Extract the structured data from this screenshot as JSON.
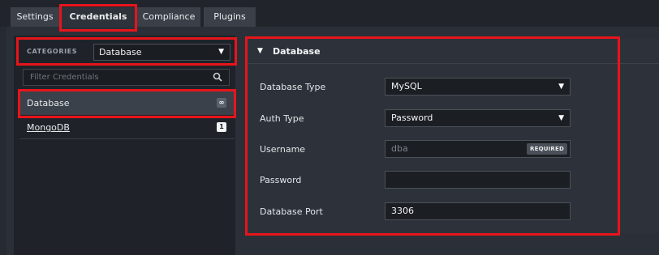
{
  "tabs": [
    {
      "label": "Settings"
    },
    {
      "label": "Credentials"
    },
    {
      "label": "Compliance"
    },
    {
      "label": "Plugins"
    }
  ],
  "categories": {
    "label": "CATEGORIES",
    "selected": "Database"
  },
  "filter": {
    "placeholder": "Filter Credentials"
  },
  "credential_list": [
    {
      "label": "Database",
      "badge": "∞"
    },
    {
      "label": "MongoDB",
      "badge": "1"
    }
  ],
  "form": {
    "section_title": "Database",
    "database_type": {
      "label": "Database Type",
      "value": "MySQL"
    },
    "auth_type": {
      "label": "Auth Type",
      "value": "Password"
    },
    "username": {
      "label": "Username",
      "placeholder": "dba",
      "badge": "REQUIRED"
    },
    "password": {
      "label": "Password",
      "value": ""
    },
    "database_port": {
      "label": "Database Port",
      "value": "3306"
    }
  },
  "colors": {
    "highlight": "#e8141b",
    "background": "#262a31",
    "panel": "#2d323a",
    "input": "#1b1e23"
  }
}
